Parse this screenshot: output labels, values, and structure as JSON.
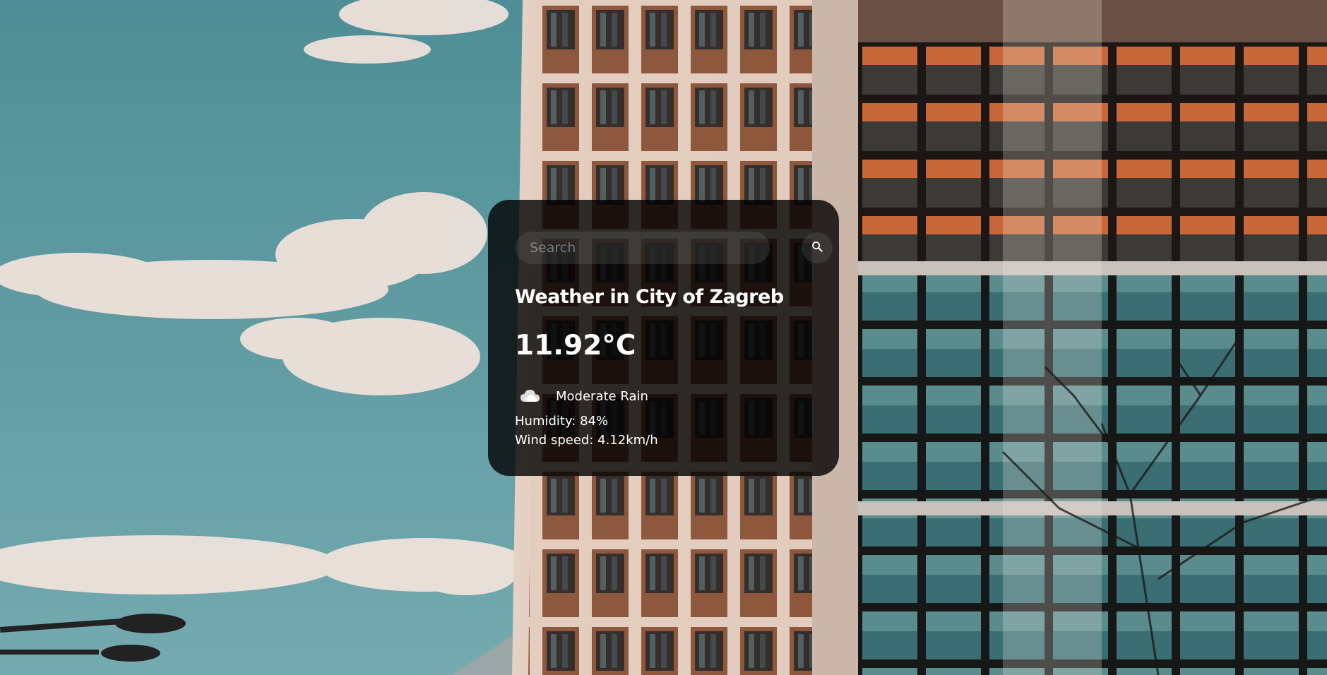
{
  "search": {
    "placeholder": "Search",
    "value": ""
  },
  "weather": {
    "title": "Weather in City of Zagreb",
    "temperature": "11.92°C",
    "condition": "Moderate Rain",
    "humidity": "Humidity: 84%",
    "wind": "Wind speed: 4.12km/h"
  },
  "icons": {
    "search": "search-icon",
    "condition": "cloud-rain-icon"
  },
  "colors": {
    "sky": "#5e9a9f",
    "card_bg": "rgba(0,0,0,0.8)",
    "text": "#ffffff"
  }
}
